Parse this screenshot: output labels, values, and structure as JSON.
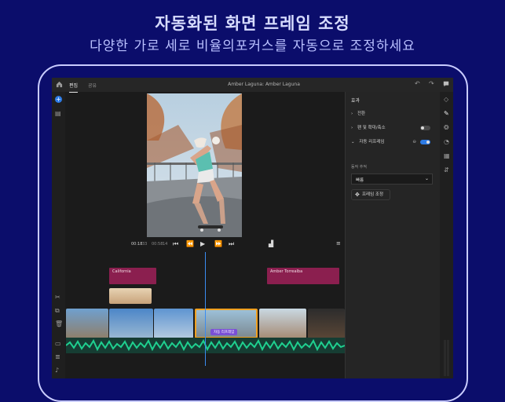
{
  "promo": {
    "headline": "자동화된 화면 프레임 조정",
    "subline": "다양한 가로 세로 비율의포커스를 자동으로 조정하세요"
  },
  "topbar": {
    "tabs": [
      {
        "label": "편집",
        "active": true
      },
      {
        "label": "공유",
        "active": false
      }
    ],
    "project_title": "Amber Laguna: Amber Laguna"
  },
  "transport": {
    "current_time": "00:18",
    "current_frames": "33",
    "duration": "00:58",
    "duration_frames": "14"
  },
  "panel": {
    "title": "효과",
    "rows": [
      {
        "label": "전환",
        "chevron": "›"
      },
      {
        "label": "팬 및 확대/축소",
        "chevron": "›",
        "toggle": false
      },
      {
        "label": "자동 리프레임",
        "chevron": "⌄",
        "toggle": true
      }
    ],
    "tracking_label": "동작 추적",
    "tracking_value": "빠름",
    "frame_button": "프레임 조정"
  },
  "timeline": {
    "title_clips": [
      {
        "label": "California"
      },
      {
        "label": "Amber Torrealba"
      }
    ],
    "selected_clip_label": "자동 리프레임"
  },
  "colors": {
    "background": "#0b0d6b",
    "accent": "#2d7be5",
    "title_clip": "#8b1f4f",
    "audio_wave": "#1fcf8f",
    "selected_clip": "#f0a020"
  }
}
